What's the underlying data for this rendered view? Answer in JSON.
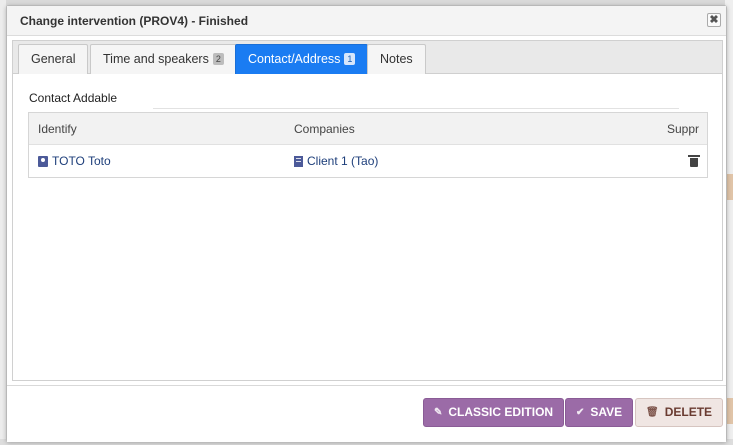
{
  "dialog": {
    "title": "Change intervention (PROV4) - Finished",
    "close_label": "✖"
  },
  "tabs": [
    {
      "label": "General",
      "badge": ""
    },
    {
      "label": "Time and speakers",
      "badge": "2"
    },
    {
      "label": "Contact/Address",
      "badge": "1"
    },
    {
      "label": "Notes",
      "badge": ""
    }
  ],
  "section": {
    "label": "Contact Addable"
  },
  "table": {
    "columns": [
      "Identify",
      "Companies",
      "Suppr"
    ],
    "rows": [
      {
        "identify": "TOTO Toto",
        "company": "Client 1 (Tao)"
      }
    ]
  },
  "footer": {
    "classic_edition_label": "CLASSIC EDITION",
    "save_label": "SAVE",
    "delete_label": "DELETE"
  },
  "icons": {
    "contact": "contact-card-icon",
    "company": "building-icon",
    "delete_row": "trash-icon",
    "classic": "pencil-icon",
    "save": "check-icon",
    "delete": "trash-icon"
  },
  "colors": {
    "active_tab": "#1a7cf2",
    "primary_button": "#9b6ba7",
    "delete_button": "#f0e6e3",
    "link_text": "#1d3e7a"
  },
  "state": {
    "active_tab": "Contact/Address"
  }
}
